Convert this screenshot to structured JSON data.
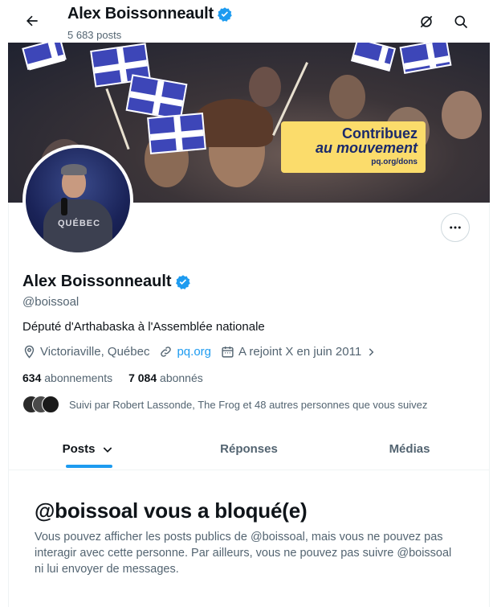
{
  "header": {
    "name": "Alex Boissonneault",
    "post_count": "5 683 posts"
  },
  "banner": {
    "promo_line1": "Contribuez",
    "promo_line2": "au mouvement",
    "promo_url": "pq.org/dons"
  },
  "avatar": {
    "shirt_text": "QUÉBEC"
  },
  "profile": {
    "name": "Alex Boissonneault",
    "handle": "@boissoal",
    "bio": "Député d'Arthabaska à l'Assemblée nationale",
    "location": "Victoriaville, Québec",
    "website": "pq.org",
    "joined": "A rejoint X en juin 2011",
    "following_count": "634",
    "following_label": "abonnements",
    "followers_count": "7 084",
    "followers_label": "abonnés",
    "followed_by": "Suivi par Robert Lassonde, The Frog et 48 autres personnes que vous suivez"
  },
  "tabs": [
    {
      "label": "Posts",
      "active": true
    },
    {
      "label": "Réponses",
      "active": false
    },
    {
      "label": "Médias",
      "active": false
    }
  ],
  "blocked": {
    "title": "@boissoal vous a bloqué(e)",
    "message": "Vous pouvez afficher les posts publics de @boissoal, mais vous ne pouvez pas interagir avec cette personne. Par ailleurs, vous ne pouvez pas suivre @boissoal ni lui envoyer de messages."
  },
  "colors": {
    "accent": "#1d9bf0",
    "verified": "#1d9bf0",
    "secondary_text": "#536471"
  },
  "icons": [
    "back-arrow-icon",
    "verified-badge-icon",
    "translate-off-icon",
    "search-icon",
    "more-icon",
    "location-icon",
    "link-icon",
    "calendar-icon",
    "chevron-right-icon",
    "chevron-down-icon"
  ]
}
